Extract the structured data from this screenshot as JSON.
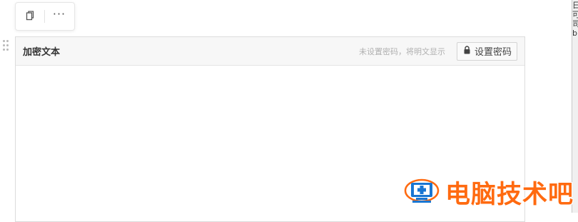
{
  "toolbar": {
    "copy_icon": "copy-icon",
    "more_label": "···"
  },
  "block": {
    "title": "加密文本",
    "hint": "未设置密码，将明文显示",
    "set_password_label": "设置密码",
    "lock_icon": "lock-icon",
    "body_text": ""
  },
  "side_window": {
    "glyphs": [
      "日",
      "可",
      "司",
      "b"
    ]
  },
  "watermark": {
    "text": "电脑技术吧",
    "logo": "monitor-cross-logo"
  },
  "colors": {
    "watermark": "#ff6a10",
    "logo_blue": "#1976d2",
    "header_bg": "#f7f7f7",
    "hint": "#b0b0b0"
  }
}
